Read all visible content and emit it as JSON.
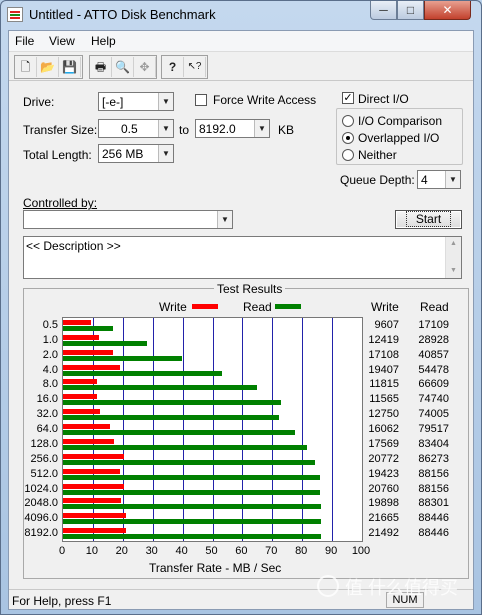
{
  "window": {
    "title": "Untitled - ATTO Disk Benchmark",
    "min_glyph": "─",
    "max_glyph": "□",
    "close_glyph": "✕"
  },
  "menu": [
    "File",
    "View",
    "Help"
  ],
  "toolbar": {
    "icons": [
      "new-file-icon",
      "open-folder-icon",
      "save-icon",
      "print-icon",
      "print-preview-icon",
      "move-icon",
      "help-icon",
      "context-help-icon"
    ],
    "glyphs": [
      "🗋",
      "📂",
      "💾",
      "🖶",
      "🔍",
      "✥",
      "?",
      "↖?"
    ]
  },
  "form": {
    "drive_label": "Drive:",
    "drive_value": "[-e-]",
    "force_write_label": "Force Write Access",
    "transfer_size_label": "Transfer Size:",
    "transfer_from": "0.5",
    "to_label": "to",
    "transfer_to": "8192.0",
    "kb_label": "KB",
    "total_length_label": "Total Length:",
    "total_length_value": "256 MB",
    "direct_io_label": "Direct I/O",
    "direct_io_checked": true,
    "io_comparison_label": "I/O Comparison",
    "overlapped_io_label": "Overlapped I/O",
    "neither_label": "Neither",
    "selected_mode": "Overlapped I/O",
    "queue_depth_label": "Queue Depth:",
    "queue_depth_value": "4",
    "controlled_by_label": "Controlled by:",
    "controlled_by_value": "",
    "start_label": "Start",
    "description": "<< Description >>"
  },
  "results": {
    "title": "Test Results",
    "write_legend": "Write",
    "read_legend": "Read",
    "write_col_header": "Write",
    "read_col_header": "Read",
    "x_axis_title": "Transfer Rate - MB / Sec"
  },
  "chart_data": {
    "type": "bar",
    "orientation": "horizontal",
    "categories": [
      "0.5",
      "1.0",
      "2.0",
      "4.0",
      "8.0",
      "16.0",
      "32.0",
      "64.0",
      "128.0",
      "256.0",
      "512.0",
      "1024.0",
      "2048.0",
      "4096.0",
      "8192.0"
    ],
    "series": [
      {
        "name": "Write",
        "color": "#ff0000",
        "values": [
          9607,
          12419,
          17108,
          19407,
          11815,
          11565,
          12750,
          16062,
          17569,
          20772,
          19423,
          20760,
          19898,
          21665,
          21492
        ]
      },
      {
        "name": "Read",
        "color": "#008000",
        "values": [
          17109,
          28928,
          40857,
          54478,
          66609,
          74740,
          74005,
          79517,
          83404,
          86273,
          88156,
          88156,
          88301,
          88446,
          88446
        ]
      }
    ],
    "value_scale_note_units": "KB/s",
    "xlabel": "Transfer Rate - MB / Sec",
    "xlim": [
      0,
      100
    ],
    "xticks": [
      "0",
      "10",
      "20",
      "30",
      "40",
      "50",
      "60",
      "70",
      "80",
      "90",
      "100"
    ]
  },
  "statusbar": {
    "text": "For Help, press F1",
    "num": "NUM"
  },
  "watermark": "值 什么值得买"
}
